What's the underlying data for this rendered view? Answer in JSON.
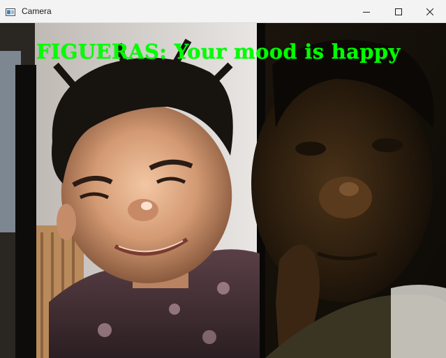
{
  "window": {
    "title": "Camera",
    "app_icon": "camera-app-icon",
    "controls": {
      "minimize_icon": "minimize-icon",
      "maximize_icon": "maximize-icon",
      "close_icon": "close-icon"
    }
  },
  "feed": {
    "overlay_text": "FIGUERAS: Your mood is happy",
    "overlay_color": "#00ff00"
  }
}
